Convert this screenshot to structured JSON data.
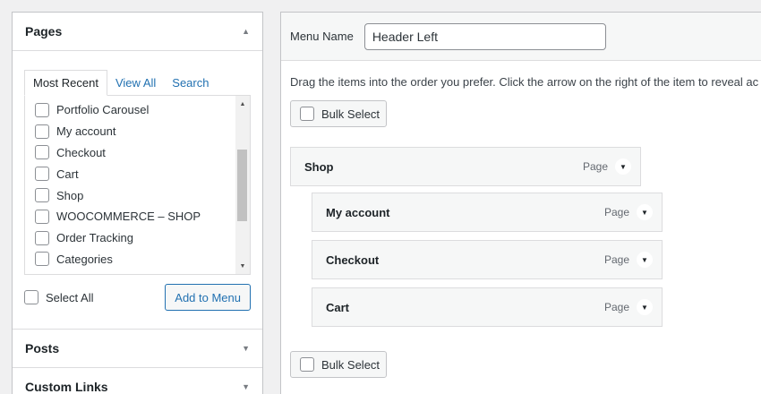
{
  "left": {
    "pages": {
      "title": "Pages",
      "collapse_arrow": "▲",
      "tabs": [
        {
          "label": "Most Recent"
        },
        {
          "label": "View All"
        },
        {
          "label": "Search"
        }
      ],
      "items": [
        {
          "label": "Portfolio Carousel"
        },
        {
          "label": "My account"
        },
        {
          "label": "Checkout"
        },
        {
          "label": "Cart"
        },
        {
          "label": "Shop"
        },
        {
          "label": "WOOCOMMERCE – SHOP"
        },
        {
          "label": "Order Tracking"
        },
        {
          "label": "Categories"
        }
      ],
      "select_all_label": "Select All",
      "add_button_label": "Add to Menu"
    },
    "posts": {
      "title": "Posts",
      "arrow": "▼"
    },
    "custom_links": {
      "title": "Custom Links",
      "arrow": "▼"
    }
  },
  "right": {
    "menu_name_label": "Menu Name",
    "menu_name_value": "Header Left",
    "instructions": "Drag the items into the order you prefer. Click the arrow on the right of the item to reveal ac",
    "bulk_select_label": "Bulk Select",
    "menu_items": [
      {
        "title": "Shop",
        "type": "Page"
      },
      {
        "title": "My account",
        "type": "Page"
      },
      {
        "title": "Checkout",
        "type": "Page"
      },
      {
        "title": "Cart",
        "type": "Page"
      }
    ],
    "toggle_glyph": "▼"
  },
  "colors": {
    "link_blue": "#2271b1",
    "border": "#c3c4c7",
    "background": "#f0f0f1"
  }
}
